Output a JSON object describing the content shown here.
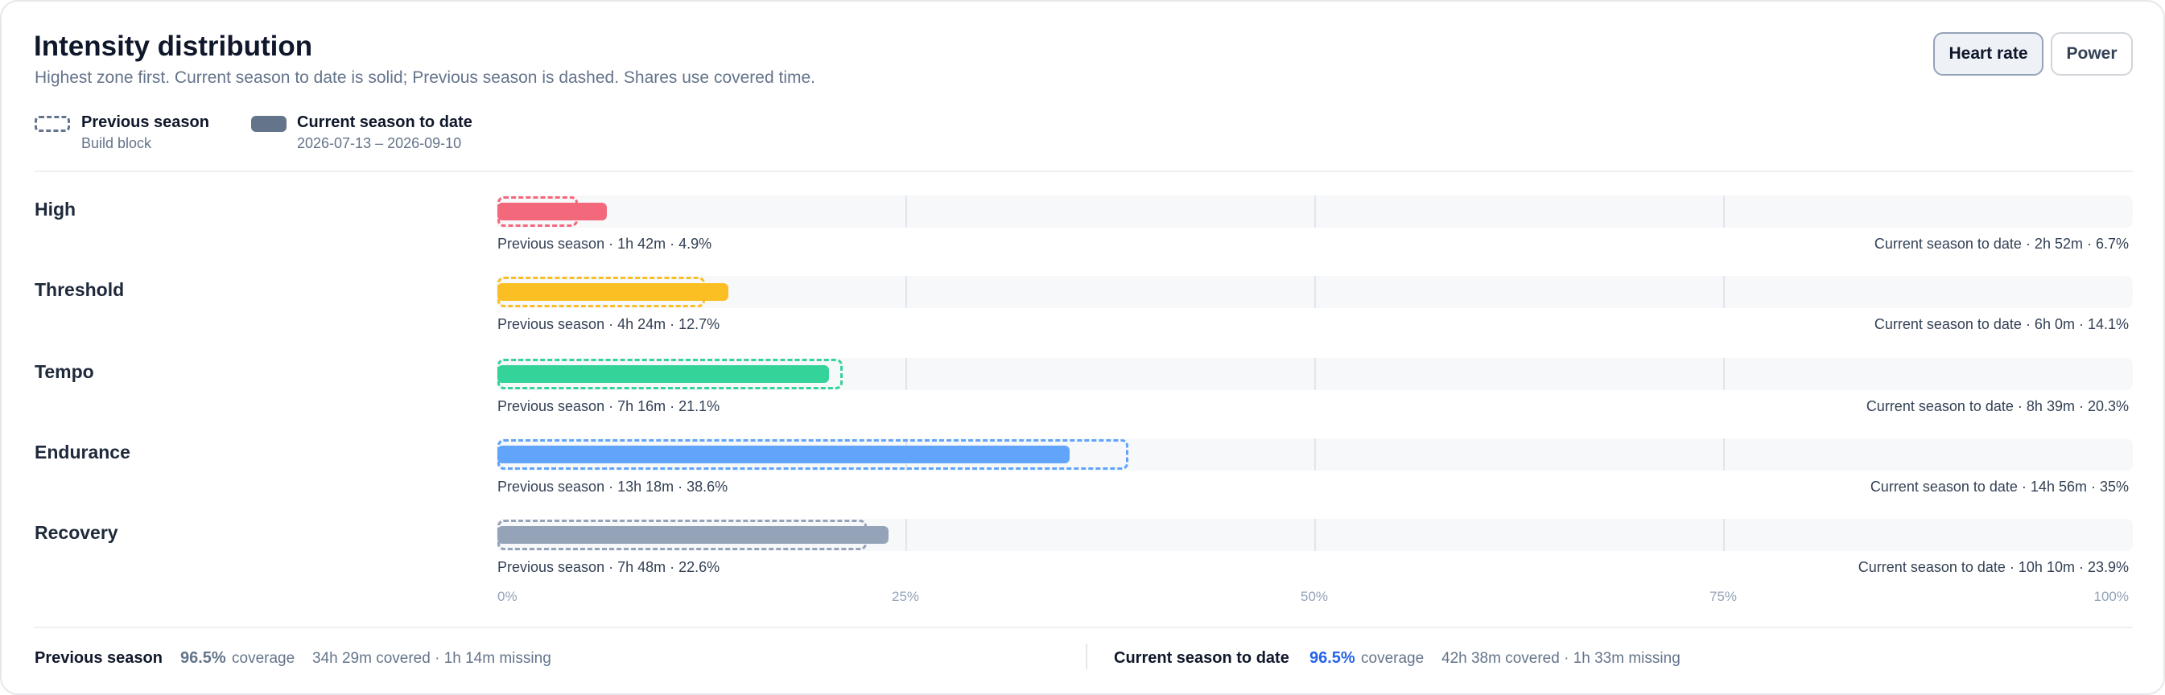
{
  "header": {
    "title": "Intensity distribution",
    "subtitle": "Highest zone first. Current season to date is solid; Previous season is dashed. Shares use covered time.",
    "toggle_heart_rate": "Heart rate",
    "toggle_power": "Power",
    "active_toggle": "Heart rate"
  },
  "legend": {
    "previous": {
      "name": "Previous season",
      "sub": "Build block"
    },
    "current": {
      "name": "Current season to date",
      "sub": "2026-07-13 – 2026-09-10"
    }
  },
  "chart_data": {
    "type": "bar",
    "orientation": "horizontal",
    "categories": [
      "High",
      "Threshold",
      "Tempo",
      "Endurance",
      "Recovery"
    ],
    "series": [
      {
        "name": "Previous season",
        "style": "dashed",
        "values": [
          4.9,
          12.7,
          21.1,
          38.6,
          22.6
        ]
      },
      {
        "name": "Current season to date",
        "style": "solid",
        "values": [
          6.7,
          14.1,
          20.3,
          35,
          23.9
        ]
      }
    ],
    "colors": [
      "#f4687c",
      "#fbbf24",
      "#34d399",
      "#60a5fa",
      "#94a3b8"
    ],
    "xlim": [
      0,
      100
    ],
    "x_unit": "%",
    "ticks": [
      "0%",
      "25%",
      "50%",
      "75%",
      "100%"
    ],
    "grid": true,
    "captions": [
      {
        "previous": "Previous season · 1h 42m · 4.9%",
        "current": "Current season to date · 2h 52m · 6.7%"
      },
      {
        "previous": "Previous season · 4h 24m · 12.7%",
        "current": "Current season to date · 6h 0m · 14.1%"
      },
      {
        "previous": "Previous season · 7h 16m · 21.1%",
        "current": "Current season to date · 8h 39m · 20.3%"
      },
      {
        "previous": "Previous season · 13h 18m · 38.6%",
        "current": "Current season to date · 14h 56m · 35%"
      },
      {
        "previous": "Previous season · 7h 48m · 22.6%",
        "current": "Current season to date · 10h 10m · 23.9%"
      }
    ]
  },
  "footer": {
    "previous": {
      "label": "Previous season",
      "pct": "96.5%",
      "coverage_word": "coverage",
      "detail": "34h 29m covered · 1h 14m missing"
    },
    "current": {
      "label": "Current season to date",
      "pct": "96.5%",
      "coverage_word": "coverage",
      "detail": "42h 38m covered · 1h 33m missing"
    },
    "accent": "#2563eb"
  }
}
